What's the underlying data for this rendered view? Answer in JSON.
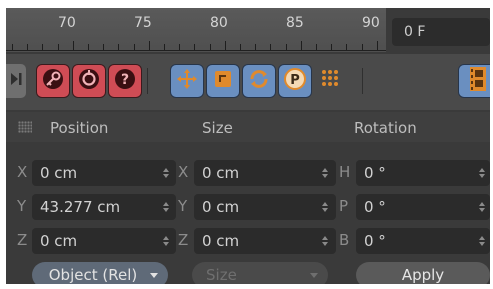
{
  "timeline": {
    "tick_labels": [
      "70",
      "75",
      "80",
      "85",
      "90"
    ],
    "current_frame": "0 F"
  },
  "toolbar": {
    "icons": [
      "play-end-icon",
      "keyframe-icon",
      "autokey-icon",
      "help-icon",
      "move-icon",
      "scale-icon",
      "rotate-icon",
      "point-icon",
      "dots-icon",
      "film-icon"
    ]
  },
  "coordinates": {
    "headers": {
      "position": "Position",
      "size": "Size",
      "rotation": "Rotation"
    },
    "rows": [
      {
        "pos_axis": "X",
        "pos_value": "0 cm",
        "size_axis": "X",
        "size_value": "0 cm",
        "rot_axis": "H",
        "rot_value": "0 °"
      },
      {
        "pos_axis": "Y",
        "pos_value": "43.277 cm",
        "size_axis": "Y",
        "size_value": "0 cm",
        "rot_axis": "P",
        "rot_value": "0 °"
      },
      {
        "pos_axis": "Z",
        "pos_value": "0 cm",
        "size_axis": "Z",
        "size_value": "0 cm",
        "rot_axis": "B",
        "rot_value": "0 °"
      }
    ],
    "mode_dropdown": "Object (Rel)",
    "size_dropdown": "Size",
    "apply_label": "Apply"
  },
  "colors": {
    "red_button": "#cf4c55",
    "blue_button": "#6a8fc0",
    "field_bg": "#2b2b2b",
    "panel_bg": "#3a3a3a"
  }
}
